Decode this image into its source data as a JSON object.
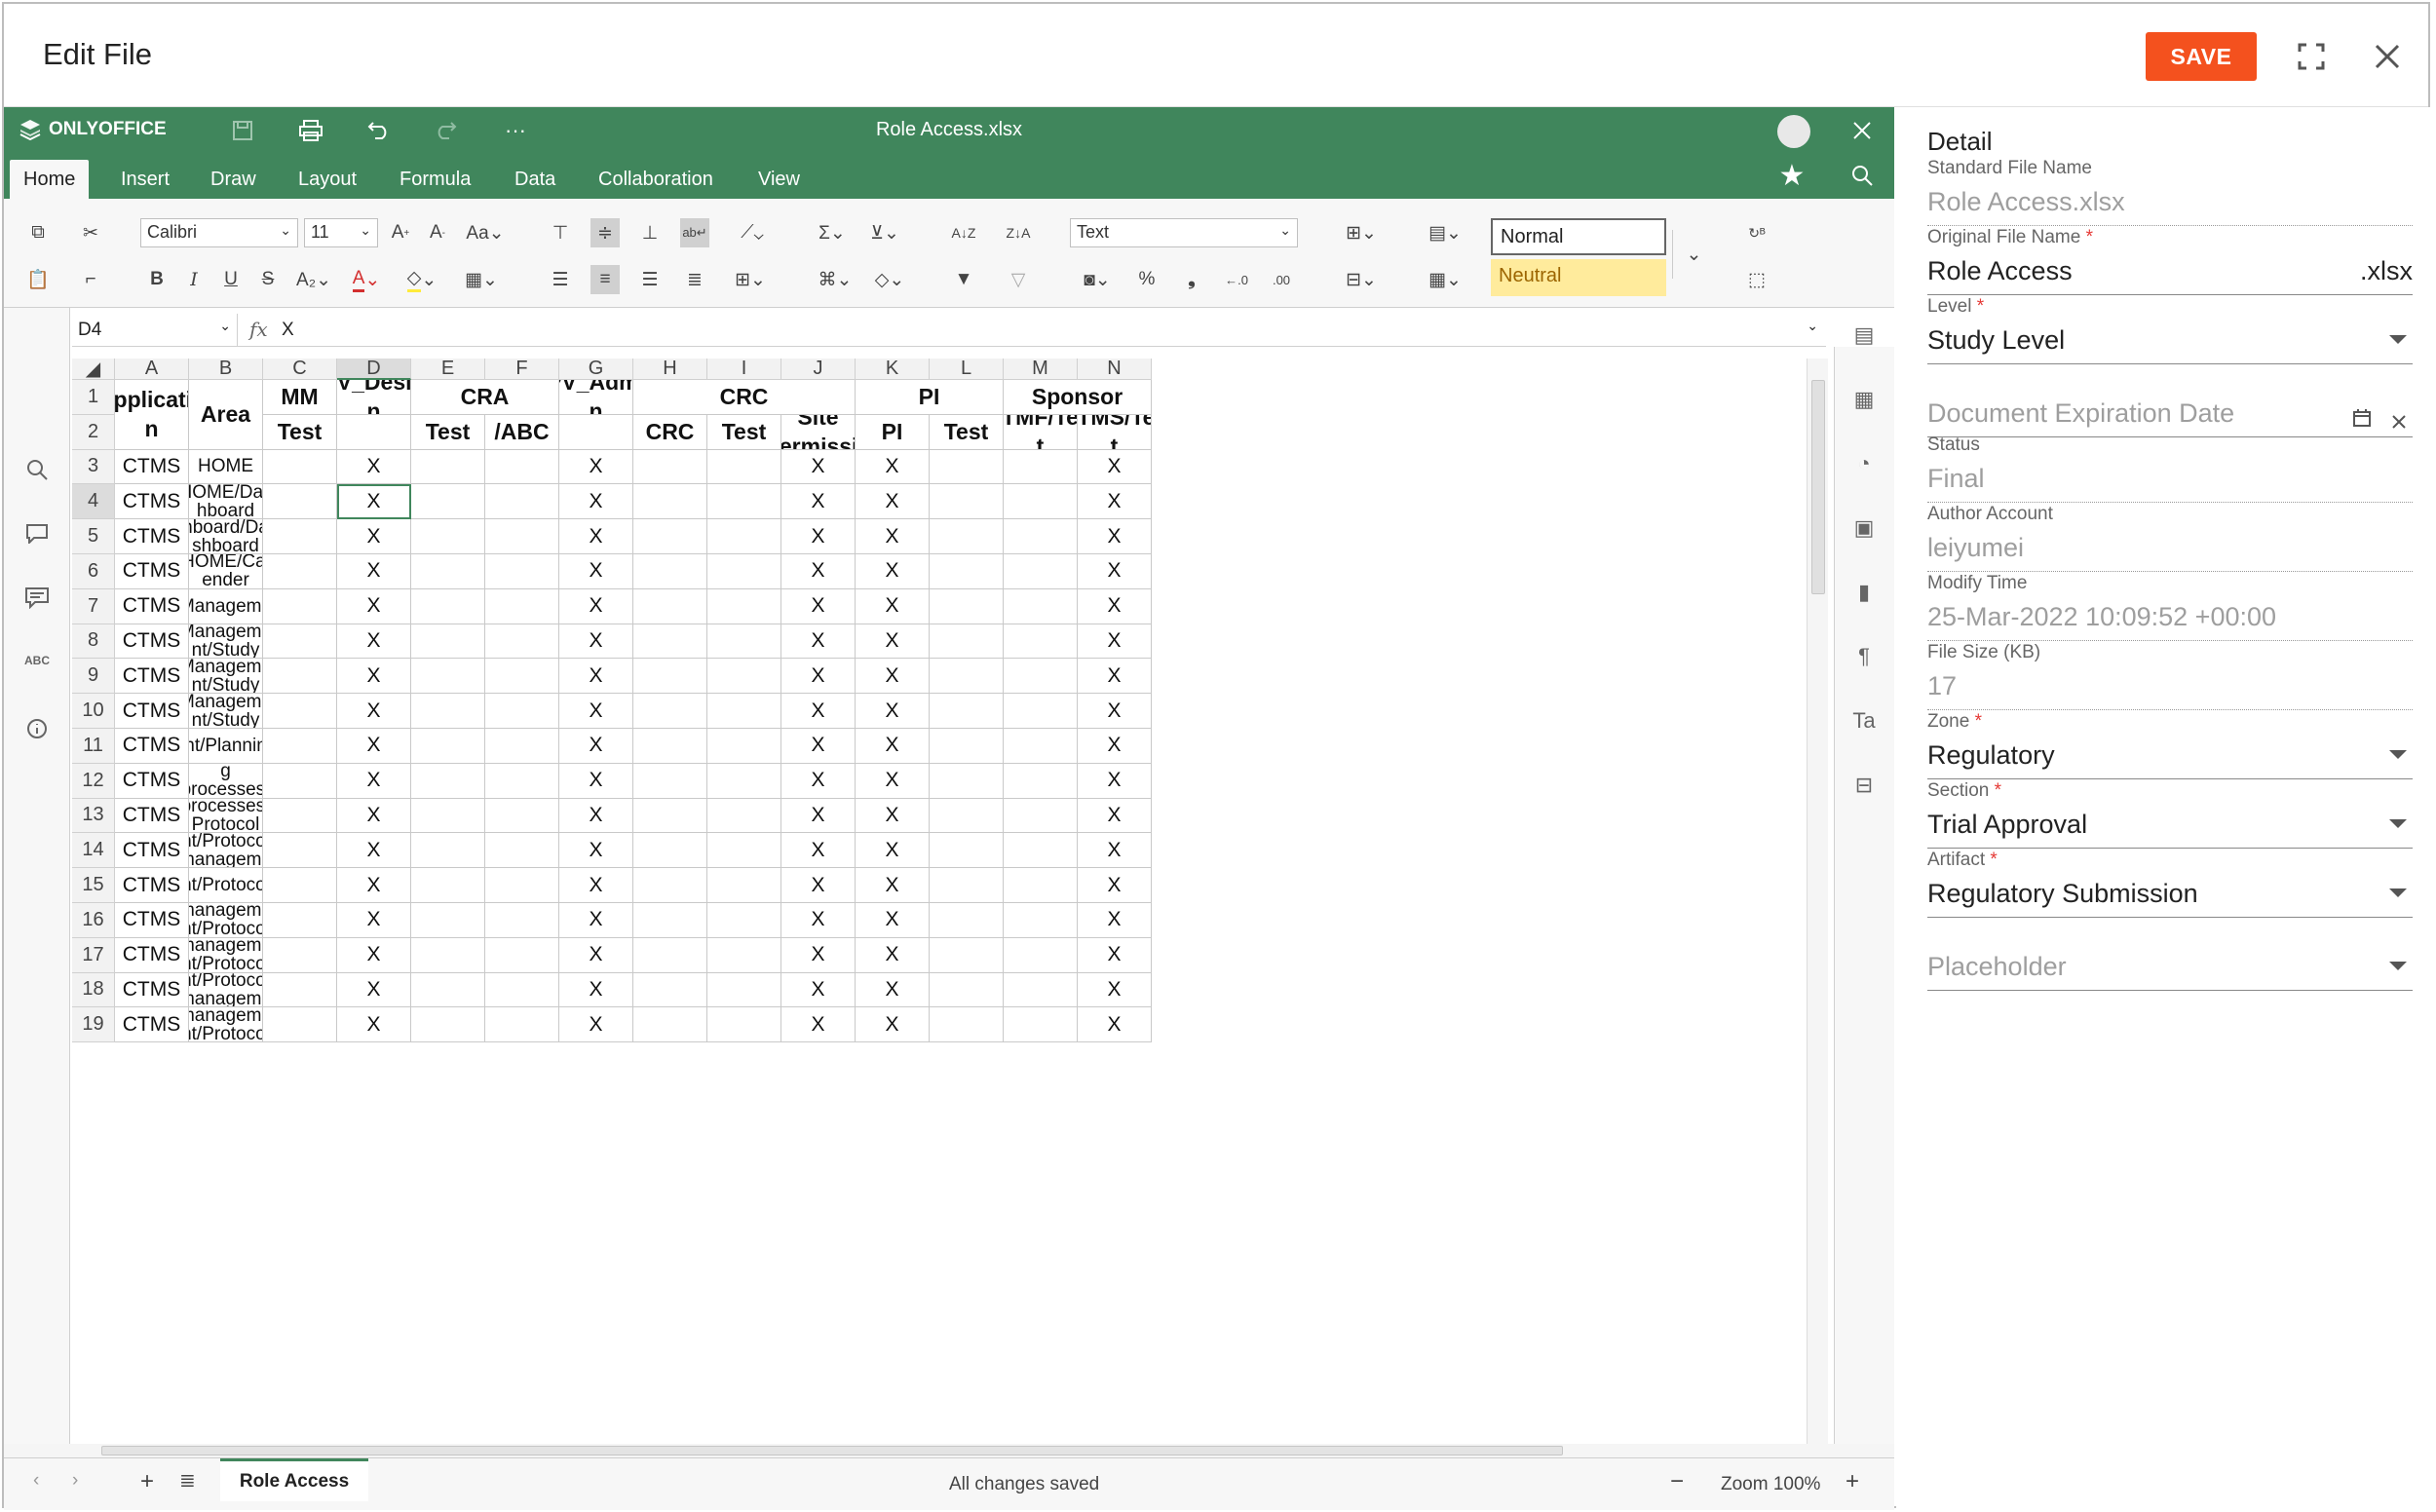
{
  "dialog": {
    "title": "Edit File",
    "save_label": "SAVE"
  },
  "editor": {
    "brand": "ONLYOFFICE",
    "doc_title": "Role Access.xlsx",
    "tabs": [
      "Home",
      "Insert",
      "Draw",
      "Layout",
      "Formula",
      "Data",
      "Collaboration",
      "View"
    ],
    "active_tab": "Home",
    "font_name": "Calibri",
    "font_size": "11",
    "number_format": "Text",
    "cell_styles": {
      "normal": "Normal",
      "neutral": "Neutral"
    },
    "name_box": "D4",
    "formula_value": "X",
    "sheet_tab": "Role Access",
    "status": "All changes saved",
    "zoom": "Zoom 100%"
  },
  "sheet": {
    "columns": [
      "A",
      "B",
      "C",
      "D",
      "E",
      "F",
      "G",
      "H",
      "I",
      "J",
      "K",
      "L",
      "M",
      "N"
    ],
    "header_row1": {
      "A": "Applicatio\nn",
      "B": "Area",
      "C": "MM",
      "D": "PV_Desig\nn",
      "EF": "CRA",
      "G": "PV_Admi\nn",
      "HJ": "CRC",
      "KL": "PI",
      "MN": "Sponsor"
    },
    "header_row2": {
      "C": "Test",
      "E": "Test",
      "F": "/ABC",
      "H": "CRC",
      "I": "Test",
      "J": "Site\nPermissio",
      "K": "PI",
      "L": "Test",
      "M": "eTMF/Tes\nt",
      "N": "CTMS/Tes\nt"
    },
    "rows": [
      {
        "num": "3",
        "app": "CTMS",
        "area": "HOME"
      },
      {
        "num": "4",
        "app": "CTMS",
        "area": "HOME/Das\nhboard"
      },
      {
        "num": "5",
        "app": "CTMS",
        "area": "hboard/Da\nshboard"
      },
      {
        "num": "6",
        "app": "CTMS",
        "area": "HOME/Cal\nender"
      },
      {
        "num": "7",
        "app": "CTMS",
        "area": "Manageme"
      },
      {
        "num": "8",
        "app": "CTMS",
        "area": "Manageme\nnt/Study"
      },
      {
        "num": "9",
        "app": "CTMS",
        "area": "Manageme\nnt/Study"
      },
      {
        "num": "10",
        "app": "CTMS",
        "area": "Manageme\nnt/Study"
      },
      {
        "num": "11",
        "app": "CTMS",
        "area": "nt/Plannin"
      },
      {
        "num": "12",
        "app": "CTMS",
        "area": "g\nprocesses/"
      },
      {
        "num": "13",
        "app": "CTMS",
        "area": "processes/\nProtocol"
      },
      {
        "num": "14",
        "app": "CTMS",
        "area": "nt/Protocol\nmanageme"
      },
      {
        "num": "15",
        "app": "CTMS",
        "area": "nt/Protocol"
      },
      {
        "num": "16",
        "app": "CTMS",
        "area": "manageme\nnt/Protocol"
      },
      {
        "num": "17",
        "app": "CTMS",
        "area": "manageme\nnt/Protocol"
      },
      {
        "num": "18",
        "app": "CTMS",
        "area": "nt/Protocol\nmanageme"
      },
      {
        "num": "19",
        "app": "CTMS",
        "area": "manageme\nnt/Protocol"
      }
    ],
    "mark": "X",
    "marked_columns": [
      "D",
      "G",
      "J",
      "K",
      "N"
    ],
    "header_row_nums": [
      "1",
      "2"
    ]
  },
  "panel": {
    "title": "Detail",
    "fields": [
      {
        "label": "Standard File Name",
        "value": "Role Access.xlsx",
        "required": false,
        "dim": true
      },
      {
        "label": "Original File Name",
        "value": "Role Access",
        "suffix": ".xlsx",
        "required": true,
        "dim": false
      },
      {
        "label": "Level",
        "value": "Study Level",
        "required": true,
        "dim": false,
        "dropdown": true
      },
      {
        "label": "",
        "value": "Document Expiration Date",
        "required": false,
        "dim": true,
        "date": true
      },
      {
        "label": "Status",
        "value": "Final",
        "required": false,
        "dim": true
      },
      {
        "label": "Author Account",
        "value": "leiyumei",
        "required": false,
        "dim": true
      },
      {
        "label": "Modify Time",
        "value": "25-Mar-2022 10:09:52 +00:00",
        "required": false,
        "dim": true
      },
      {
        "label": "File Size (KB)",
        "value": "17",
        "required": false,
        "dim": true
      },
      {
        "label": "Zone",
        "value": "Regulatory",
        "required": true,
        "dim": false,
        "dropdown": true
      },
      {
        "label": "Section",
        "value": "Trial Approval",
        "required": true,
        "dim": false,
        "dropdown": true
      },
      {
        "label": "Artifact",
        "value": "Regulatory Submission",
        "required": true,
        "dim": false,
        "dropdown": true
      },
      {
        "label": "",
        "value": "Placeholder",
        "required": false,
        "dim": true,
        "dropdown": true
      }
    ]
  },
  "colors": {
    "brand_green": "#40865c",
    "save_orange": "#f4511e",
    "neutral_fill": "#ffeb9c"
  }
}
